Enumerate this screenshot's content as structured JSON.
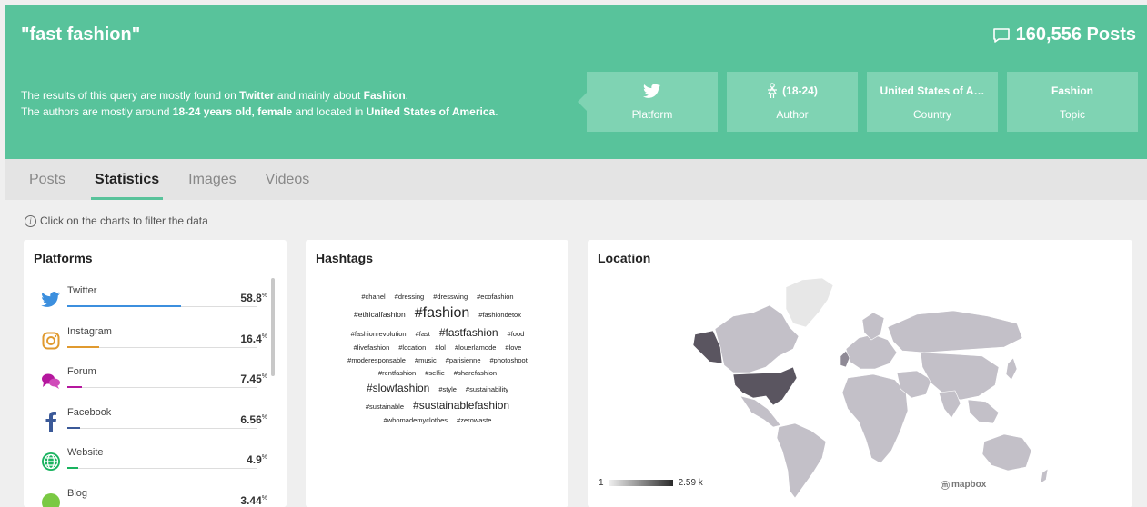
{
  "header": {
    "query": "\"fast fashion\"",
    "posts_count": "160,556 Posts",
    "summary_line1": {
      "p1": "The results of this query are mostly found on ",
      "platform": "Twitter",
      "p2": " and mainly about ",
      "topic": "Fashion",
      "p3": "."
    },
    "summary_line2": {
      "p1": "The authors are mostly around ",
      "age": "18-24 years old, female",
      "p2": " and located in ",
      "country": "United States of America",
      "p3": "."
    },
    "cards": [
      {
        "top": "",
        "label": "Platform",
        "icon": "twitter-icon"
      },
      {
        "top": "(18-24)",
        "label": "Author",
        "icon": "female-icon"
      },
      {
        "top": "United States of A…",
        "label": "Country"
      },
      {
        "top": "Fashion",
        "label": "Topic"
      }
    ]
  },
  "tabs": [
    "Posts",
    "Statistics",
    "Images",
    "Videos"
  ],
  "active_tab": "Statistics",
  "hint": "Click on the charts to filter the data",
  "panels": {
    "platforms": {
      "title": "Platforms",
      "items": [
        {
          "name": "Twitter",
          "value": "58.8",
          "unit": "%",
          "share": 0.588,
          "color": "#3c8fde",
          "icon": "twitter-icon"
        },
        {
          "name": "Instagram",
          "value": "16.4",
          "unit": "%",
          "share": 0.164,
          "color": "#e09a2f",
          "icon": "instagram-icon"
        },
        {
          "name": "Forum",
          "value": "7.45",
          "unit": "%",
          "share": 0.0745,
          "color": "#b5179e",
          "icon": "forum-icon"
        },
        {
          "name": "Facebook",
          "value": "6.56",
          "unit": "%",
          "share": 0.0656,
          "color": "#3b5998",
          "icon": "facebook-icon"
        },
        {
          "name": "Website",
          "value": "4.9",
          "unit": "%",
          "share": 0.049,
          "color": "#19b35f",
          "icon": "globe-icon"
        },
        {
          "name": "Blog",
          "value": "3.44",
          "unit": "%",
          "share": 0.0344,
          "color": "#7ac943",
          "icon": "blog-icon"
        }
      ]
    },
    "hashtags": {
      "title": "Hashtags",
      "lines": [
        [
          [
            "#chanel",
            "xs"
          ],
          [
            "#dressing",
            "xs"
          ],
          [
            "#dresswing",
            "xs"
          ],
          [
            "#ecofashion",
            "xs"
          ]
        ],
        [
          [
            "#ethicalfashion",
            "s"
          ],
          [
            "#fashion",
            "l"
          ],
          [
            "#fashiondetox",
            "xs"
          ]
        ],
        [
          [
            "#fashionrevolution",
            "xs"
          ],
          [
            "#fast",
            "xs"
          ],
          [
            "#fastfashion",
            "m"
          ],
          [
            "#food",
            "xs"
          ]
        ],
        [
          [
            "#livefashion",
            "xs"
          ],
          [
            "#location",
            "xs"
          ],
          [
            "#lol",
            "xs"
          ],
          [
            "#louerlamode",
            "xs"
          ],
          [
            "#love",
            "xs"
          ]
        ],
        [
          [
            "#moderesponsable",
            "xs"
          ],
          [
            "#music",
            "xs"
          ],
          [
            "#parisienne",
            "xs"
          ],
          [
            "#photoshoot",
            "xs"
          ]
        ],
        [
          [
            "#rentfashion",
            "xs"
          ],
          [
            "#selfie",
            "xs"
          ],
          [
            "#sharefashion",
            "xs"
          ]
        ],
        [
          [
            "#slowfashion",
            "m"
          ],
          [
            "#style",
            "xs"
          ],
          [
            "#sustainability",
            "xs"
          ]
        ],
        [
          [
            "#sustainable",
            "xs"
          ],
          [
            "#sustainablefashion",
            "m"
          ]
        ],
        [
          [
            "#whomademyclothes",
            "xs"
          ],
          [
            "#zerowaste",
            "xs"
          ]
        ]
      ]
    },
    "location": {
      "title": "Location",
      "legend_min": "1",
      "legend_max": "2.59 k",
      "attribution": "mapbox",
      "colors": {
        "max": "#5a5560",
        "mid": "#8f8a96",
        "low": "#c3c0c8",
        "none": "#e7e7e7"
      }
    }
  }
}
